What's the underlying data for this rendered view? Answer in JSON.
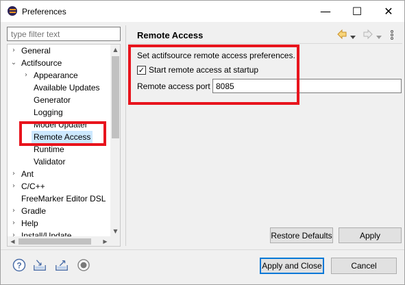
{
  "window": {
    "title": "Preferences",
    "minimize_glyph": "—",
    "maximize_glyph": "☐",
    "close_glyph": "✕"
  },
  "filter": {
    "placeholder": "type filter text"
  },
  "tree": {
    "items": [
      {
        "label": "General",
        "twisty": "›",
        "level": 0,
        "selected": false
      },
      {
        "label": "Actifsource",
        "twisty": "⌄",
        "level": 0,
        "selected": false
      },
      {
        "label": "Appearance",
        "twisty": "›",
        "level": 1,
        "selected": false
      },
      {
        "label": "Available Updates",
        "twisty": "",
        "level": 1,
        "selected": false
      },
      {
        "label": "Generator",
        "twisty": "",
        "level": 1,
        "selected": false
      },
      {
        "label": "Logging",
        "twisty": "",
        "level": 1,
        "selected": false
      },
      {
        "label": "Model Updater",
        "twisty": "",
        "level": 1,
        "selected": false
      },
      {
        "label": "Remote Access",
        "twisty": "",
        "level": 1,
        "selected": true
      },
      {
        "label": "Runtime",
        "twisty": "",
        "level": 1,
        "selected": false
      },
      {
        "label": "Validator",
        "twisty": "",
        "level": 1,
        "selected": false
      },
      {
        "label": "Ant",
        "twisty": "›",
        "level": 0,
        "selected": false
      },
      {
        "label": "C/C++",
        "twisty": "›",
        "level": 0,
        "selected": false
      },
      {
        "label": "FreeMarker Editor DSL",
        "twisty": "",
        "level": 0,
        "selected": false
      },
      {
        "label": "Gradle",
        "twisty": "›",
        "level": 0,
        "selected": false
      },
      {
        "label": "Help",
        "twisty": "›",
        "level": 0,
        "selected": false
      },
      {
        "label": "Install/Update",
        "twisty": "›",
        "level": 0,
        "selected": false
      }
    ]
  },
  "page": {
    "title": "Remote Access",
    "description": "Set actifsource remote access preferences.",
    "checkbox_label": "Start remote access at startup",
    "checkbox_checked": true,
    "port_label": "Remote access port",
    "port_value": "8085",
    "restore_defaults_label": "Restore Defaults",
    "apply_label": "Apply"
  },
  "footer": {
    "apply_close_label": "Apply and Close",
    "cancel_label": "Cancel",
    "icons": [
      "help-icon",
      "import-icon",
      "export-icon",
      "oomph-icon"
    ]
  },
  "colors": {
    "highlight": "#e8141d",
    "selection": "#cce8ff",
    "nav_back": "#e8a33d",
    "default_border": "#0078d7"
  }
}
